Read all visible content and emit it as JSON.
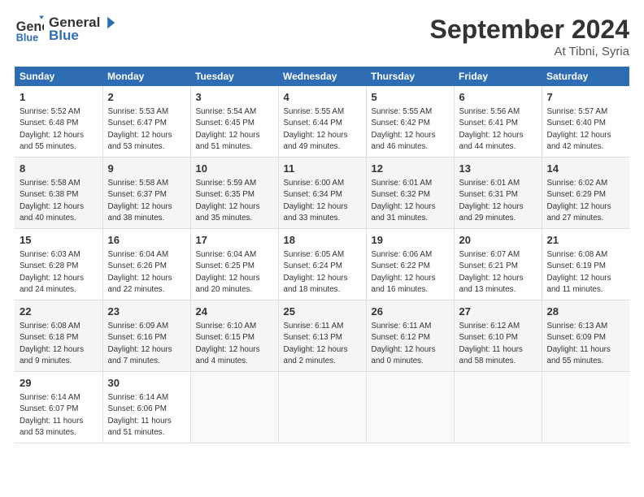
{
  "logo": {
    "line1": "General",
    "line2": "Blue"
  },
  "title": "September 2024",
  "location": "At Tibni, Syria",
  "headers": [
    "Sunday",
    "Monday",
    "Tuesday",
    "Wednesday",
    "Thursday",
    "Friday",
    "Saturday"
  ],
  "weeks": [
    [
      {
        "day": "1",
        "info": "Sunrise: 5:52 AM\nSunset: 6:48 PM\nDaylight: 12 hours\nand 55 minutes."
      },
      {
        "day": "2",
        "info": "Sunrise: 5:53 AM\nSunset: 6:47 PM\nDaylight: 12 hours\nand 53 minutes."
      },
      {
        "day": "3",
        "info": "Sunrise: 5:54 AM\nSunset: 6:45 PM\nDaylight: 12 hours\nand 51 minutes."
      },
      {
        "day": "4",
        "info": "Sunrise: 5:55 AM\nSunset: 6:44 PM\nDaylight: 12 hours\nand 49 minutes."
      },
      {
        "day": "5",
        "info": "Sunrise: 5:55 AM\nSunset: 6:42 PM\nDaylight: 12 hours\nand 46 minutes."
      },
      {
        "day": "6",
        "info": "Sunrise: 5:56 AM\nSunset: 6:41 PM\nDaylight: 12 hours\nand 44 minutes."
      },
      {
        "day": "7",
        "info": "Sunrise: 5:57 AM\nSunset: 6:40 PM\nDaylight: 12 hours\nand 42 minutes."
      }
    ],
    [
      {
        "day": "8",
        "info": "Sunrise: 5:58 AM\nSunset: 6:38 PM\nDaylight: 12 hours\nand 40 minutes."
      },
      {
        "day": "9",
        "info": "Sunrise: 5:58 AM\nSunset: 6:37 PM\nDaylight: 12 hours\nand 38 minutes."
      },
      {
        "day": "10",
        "info": "Sunrise: 5:59 AM\nSunset: 6:35 PM\nDaylight: 12 hours\nand 35 minutes."
      },
      {
        "day": "11",
        "info": "Sunrise: 6:00 AM\nSunset: 6:34 PM\nDaylight: 12 hours\nand 33 minutes."
      },
      {
        "day": "12",
        "info": "Sunrise: 6:01 AM\nSunset: 6:32 PM\nDaylight: 12 hours\nand 31 minutes."
      },
      {
        "day": "13",
        "info": "Sunrise: 6:01 AM\nSunset: 6:31 PM\nDaylight: 12 hours\nand 29 minutes."
      },
      {
        "day": "14",
        "info": "Sunrise: 6:02 AM\nSunset: 6:29 PM\nDaylight: 12 hours\nand 27 minutes."
      }
    ],
    [
      {
        "day": "15",
        "info": "Sunrise: 6:03 AM\nSunset: 6:28 PM\nDaylight: 12 hours\nand 24 minutes."
      },
      {
        "day": "16",
        "info": "Sunrise: 6:04 AM\nSunset: 6:26 PM\nDaylight: 12 hours\nand 22 minutes."
      },
      {
        "day": "17",
        "info": "Sunrise: 6:04 AM\nSunset: 6:25 PM\nDaylight: 12 hours\nand 20 minutes."
      },
      {
        "day": "18",
        "info": "Sunrise: 6:05 AM\nSunset: 6:24 PM\nDaylight: 12 hours\nand 18 minutes."
      },
      {
        "day": "19",
        "info": "Sunrise: 6:06 AM\nSunset: 6:22 PM\nDaylight: 12 hours\nand 16 minutes."
      },
      {
        "day": "20",
        "info": "Sunrise: 6:07 AM\nSunset: 6:21 PM\nDaylight: 12 hours\nand 13 minutes."
      },
      {
        "day": "21",
        "info": "Sunrise: 6:08 AM\nSunset: 6:19 PM\nDaylight: 12 hours\nand 11 minutes."
      }
    ],
    [
      {
        "day": "22",
        "info": "Sunrise: 6:08 AM\nSunset: 6:18 PM\nDaylight: 12 hours\nand 9 minutes."
      },
      {
        "day": "23",
        "info": "Sunrise: 6:09 AM\nSunset: 6:16 PM\nDaylight: 12 hours\nand 7 minutes."
      },
      {
        "day": "24",
        "info": "Sunrise: 6:10 AM\nSunset: 6:15 PM\nDaylight: 12 hours\nand 4 minutes."
      },
      {
        "day": "25",
        "info": "Sunrise: 6:11 AM\nSunset: 6:13 PM\nDaylight: 12 hours\nand 2 minutes."
      },
      {
        "day": "26",
        "info": "Sunrise: 6:11 AM\nSunset: 6:12 PM\nDaylight: 12 hours\nand 0 minutes."
      },
      {
        "day": "27",
        "info": "Sunrise: 6:12 AM\nSunset: 6:10 PM\nDaylight: 11 hours\nand 58 minutes."
      },
      {
        "day": "28",
        "info": "Sunrise: 6:13 AM\nSunset: 6:09 PM\nDaylight: 11 hours\nand 55 minutes."
      }
    ],
    [
      {
        "day": "29",
        "info": "Sunrise: 6:14 AM\nSunset: 6:07 PM\nDaylight: 11 hours\nand 53 minutes."
      },
      {
        "day": "30",
        "info": "Sunrise: 6:14 AM\nSunset: 6:06 PM\nDaylight: 11 hours\nand 51 minutes."
      },
      {
        "day": "",
        "info": ""
      },
      {
        "day": "",
        "info": ""
      },
      {
        "day": "",
        "info": ""
      },
      {
        "day": "",
        "info": ""
      },
      {
        "day": "",
        "info": ""
      }
    ]
  ]
}
